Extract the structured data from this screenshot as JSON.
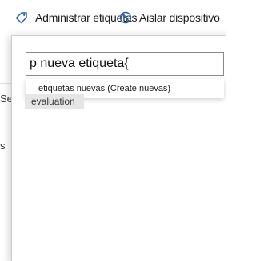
{
  "toolbar": {
    "manage_tags_label": "Administrar etiquetas",
    "manage_tags_icon": "tag-icon",
    "isolate_device_label": "Aislar dispositivo",
    "isolate_device_icon": "block-icon"
  },
  "background": {
    "left_fragment_1": "Se",
    "left_fragment_2": "s",
    "tag_chip": "evaluation"
  },
  "tag_panel": {
    "search_value": "p nueva etiqueta{",
    "suggestion": "etiquetas nuevas (Create nuevas)"
  }
}
